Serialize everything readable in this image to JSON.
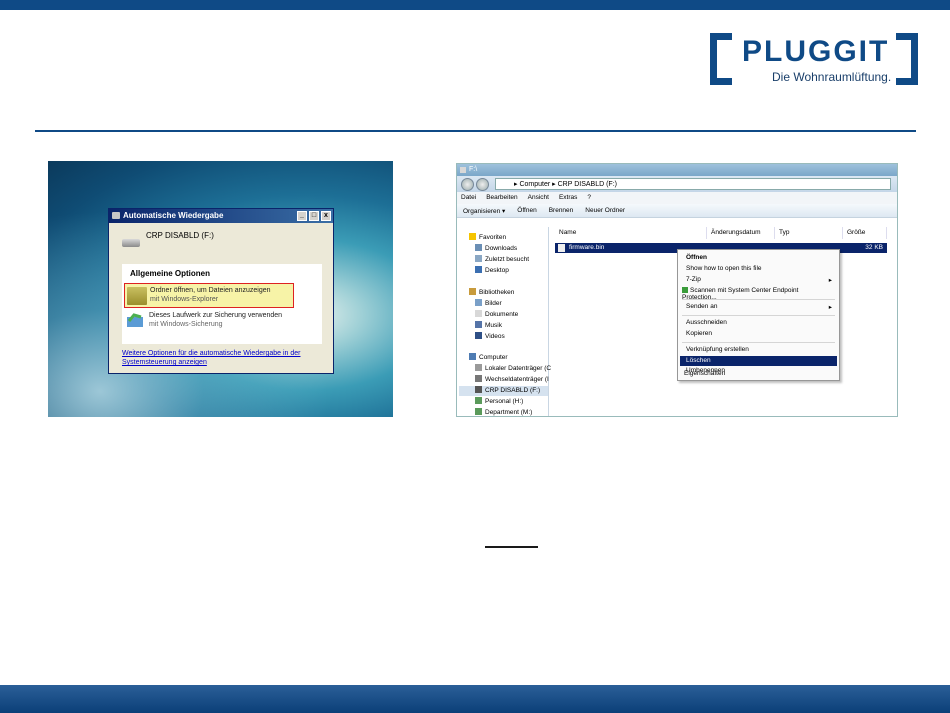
{
  "brand": {
    "name": "PLUGGIT",
    "slogan": "Die Wohnraumlüftung.",
    "color": "#0f4a86"
  },
  "autoplay": {
    "title": "Automatische Wiedergabe",
    "window_buttons": [
      "_",
      "□",
      "x"
    ],
    "drive_label": "CRP DISABLD (F:)",
    "section_header": "Allgemeine Optionen",
    "option1_line1": "Ordner öffnen, um Dateien anzuzeigen",
    "option1_line2": "mit Windows-Explorer",
    "option2_line1": "Dieses Laufwerk zur Sicherung verwenden",
    "option2_line2": "mit Windows-Sicherung",
    "more_link": "Weitere Optionen für die automatische Wiedergabe in der Systemsteuerung anzeigen"
  },
  "explorer": {
    "title": "F:\\",
    "address": "▸ Computer ▸ CRP DISABLD (F:)",
    "menu": [
      "Datei",
      "Bearbeiten",
      "Ansicht",
      "Extras",
      "?"
    ],
    "toolbar": [
      "Organisieren ▾",
      "Öffnen",
      "Brennen",
      "Neuer Ordner"
    ],
    "nav": {
      "favorites": "Favoriten",
      "favorites_items": [
        "Downloads",
        "Zuletzt besucht",
        "Desktop"
      ],
      "libraries": "Bibliotheken",
      "libraries_items": [
        "Bilder",
        "Dokumente",
        "Musik",
        "Videos"
      ],
      "computer": "Computer",
      "computer_items": [
        "Lokaler Datenträger (C",
        "Wechseldatenträger (I",
        "CRP DISABLD (F:)",
        "Personal (H:)",
        "Department (M:)"
      ]
    },
    "columns": [
      "Name",
      "Änderungsdatum",
      "Typ",
      "Größe"
    ],
    "file": {
      "name": "firmware.bin",
      "size": "32 KB"
    }
  },
  "context_menu": {
    "items": [
      "Öffnen",
      "Show how to open this file",
      "7-Zip",
      "Scannen mit System Center Endpoint Protection...",
      "Senden an",
      "Ausschneiden",
      "Kopieren",
      "Verknüpfung erstellen",
      "Löschen",
      "Umbenennen",
      "Eigenschaften"
    ],
    "highlighted": "Löschen"
  }
}
